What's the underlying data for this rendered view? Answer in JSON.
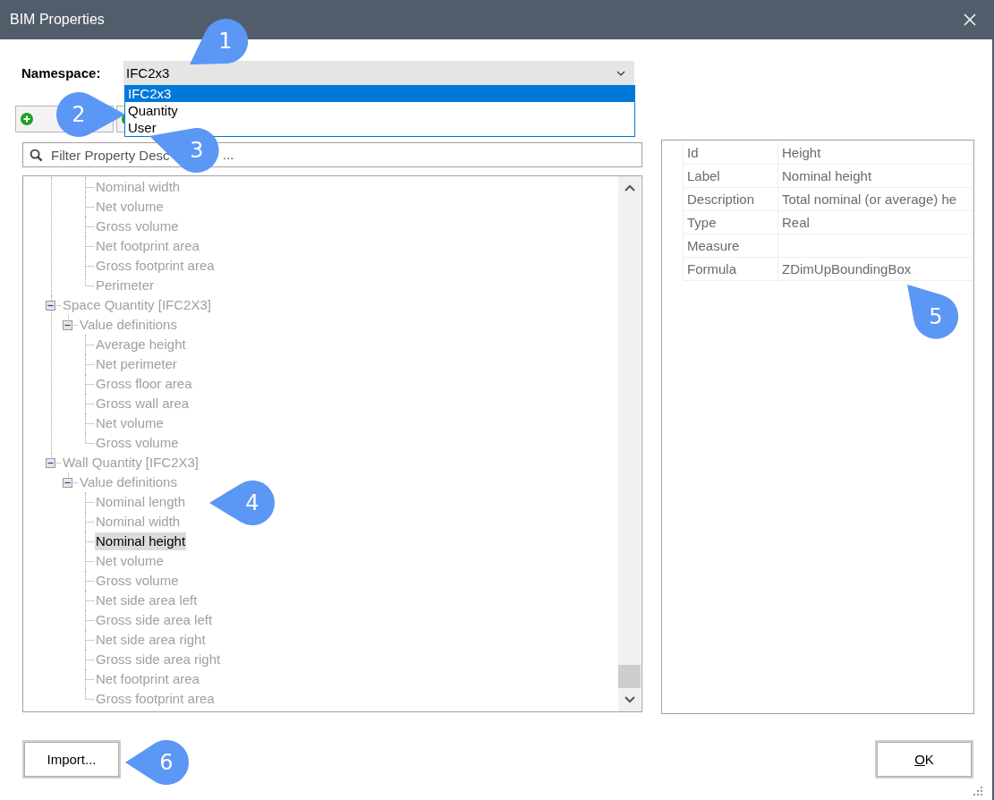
{
  "window": {
    "title": "BIM Properties"
  },
  "namespace": {
    "label": "Namespace:",
    "value": "IFC2x3",
    "options": [
      {
        "label": "IFC2x3",
        "selected": true
      },
      {
        "label": "Quantity",
        "selected": false
      },
      {
        "label": "User",
        "selected": false
      }
    ]
  },
  "filter": {
    "placeholder": "Filter Property Desc",
    "placeholder_tail": "..."
  },
  "tree": {
    "items": [
      {
        "kind": "scrolled_off",
        "children": [
          {
            "kind": "scrolled_off",
            "children": [
              {
                "kind": "leaf",
                "label": "Nominal width",
                "selected": false
              },
              {
                "kind": "leaf",
                "label": "Net volume",
                "selected": false
              },
              {
                "kind": "leaf",
                "label": "Gross volume",
                "selected": false
              },
              {
                "kind": "leaf",
                "label": "Net footprint area",
                "selected": false
              },
              {
                "kind": "leaf",
                "label": "Gross footprint area",
                "selected": false
              },
              {
                "kind": "leaf",
                "label": "Perimeter",
                "selected": false
              }
            ]
          }
        ]
      },
      {
        "kind": "group",
        "label": "Space Quantity [IFC2X3]",
        "expanded": true,
        "selected": false,
        "children": [
          {
            "kind": "group",
            "label": "Value definitions",
            "expanded": true,
            "selected": false,
            "children": [
              {
                "kind": "leaf",
                "label": "Average height",
                "selected": false
              },
              {
                "kind": "leaf",
                "label": "Net perimeter",
                "selected": false
              },
              {
                "kind": "leaf",
                "label": "Gross floor area",
                "selected": false
              },
              {
                "kind": "leaf",
                "label": "Gross wall area",
                "selected": false
              },
              {
                "kind": "leaf",
                "label": "Net volume",
                "selected": false
              },
              {
                "kind": "leaf",
                "label": "Gross volume",
                "selected": false
              }
            ]
          }
        ]
      },
      {
        "kind": "group",
        "label": "Wall Quantity [IFC2X3]",
        "expanded": true,
        "selected": false,
        "children": [
          {
            "kind": "group",
            "label": "Value definitions",
            "expanded": true,
            "selected": false,
            "children": [
              {
                "kind": "leaf",
                "label": "Nominal length",
                "selected": false
              },
              {
                "kind": "leaf",
                "label": "Nominal width",
                "selected": false
              },
              {
                "kind": "leaf",
                "label": "Nominal height",
                "selected": true
              },
              {
                "kind": "leaf",
                "label": "Net volume",
                "selected": false
              },
              {
                "kind": "leaf",
                "label": "Gross volume",
                "selected": false
              },
              {
                "kind": "leaf",
                "label": "Net side area left",
                "selected": false
              },
              {
                "kind": "leaf",
                "label": "Gross side area left",
                "selected": false
              },
              {
                "kind": "leaf",
                "label": "Net side area right",
                "selected": false
              },
              {
                "kind": "leaf",
                "label": "Gross side area right",
                "selected": false
              },
              {
                "kind": "leaf",
                "label": "Net footprint area",
                "selected": false
              },
              {
                "kind": "leaf",
                "label": "Gross footprint area",
                "selected": false
              }
            ]
          }
        ]
      }
    ]
  },
  "properties": {
    "rows": [
      {
        "name": "Id",
        "value": "Height"
      },
      {
        "name": "Label",
        "value": "Nominal height"
      },
      {
        "name": "Description",
        "value": "Total nominal (or average) he"
      },
      {
        "name": "Type",
        "value": "Real"
      },
      {
        "name": "Measure"
      },
      {
        "name": "Formula",
        "value": "ZDimUpBoundingBox"
      }
    ]
  },
  "buttons": {
    "import": "Import...",
    "ok": "OK"
  },
  "callouts": [
    {
      "number": "1"
    },
    {
      "number": "2"
    },
    {
      "number": "3"
    },
    {
      "number": "4"
    },
    {
      "number": "5"
    },
    {
      "number": "6"
    }
  ]
}
